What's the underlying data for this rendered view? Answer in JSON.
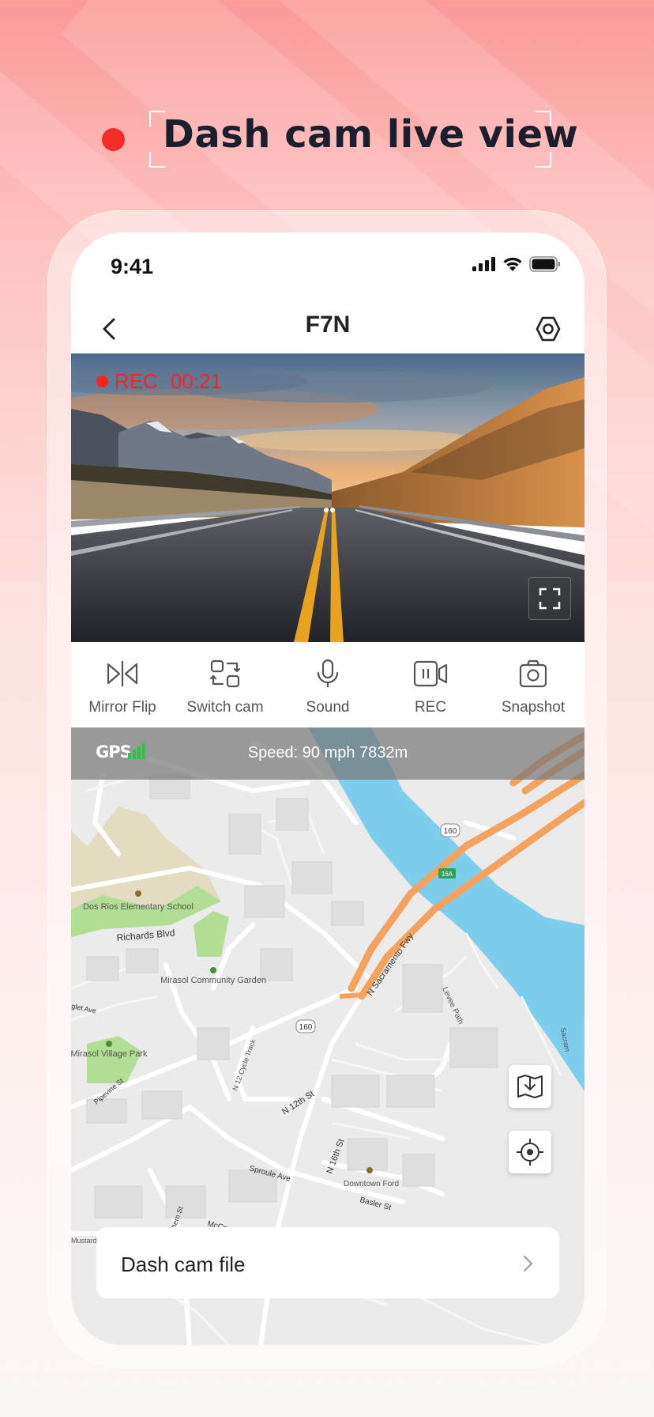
{
  "headline": {
    "title": "Dash cam live view"
  },
  "status_bar": {
    "time": "9:41"
  },
  "nav": {
    "title": "F7N"
  },
  "video": {
    "rec_label": "REC",
    "rec_timer": "00:21"
  },
  "controls": [
    {
      "label": "Mirror Flip",
      "icon": "mirror-flip-icon"
    },
    {
      "label": "Switch cam",
      "icon": "switch-cam-icon"
    },
    {
      "label": "Sound",
      "icon": "microphone-icon"
    },
    {
      "label": "REC",
      "icon": "record-video-icon"
    },
    {
      "label": "Snapshot",
      "icon": "camera-icon"
    }
  ],
  "gps": {
    "label": "GPS",
    "speed_text": "Speed: 90 mph  7832m",
    "signal_bars": 4
  },
  "map": {
    "labels": {
      "school": "Dos Rios Elementary School",
      "garden": "Mirasol Community Garden",
      "park": "Mirasol Village Park",
      "richards": "Richards Blvd",
      "sacramento_fwy": "N Sacramento Fwy",
      "levee": "Levee Path",
      "n12th": "N 12th St",
      "n16th": "N 16th St",
      "cycle": "N 12 Cycle Track",
      "sproule": "Sproule Ave",
      "basler": "Basler St",
      "mccormack": "McCormack Ave",
      "ahern": "Ahern St",
      "pipevine": "Pipevine St",
      "downtown_ford": "Downtown Ford",
      "mustard": "Mustard S",
      "glet": "glet Ave",
      "route160": "160",
      "route16a": "16A",
      "sacram": "Sacram"
    }
  },
  "file_card": {
    "label": "Dash cam file"
  },
  "colors": {
    "accent_red": "#f52a2a",
    "rec_red": "#ff1f1f",
    "river": "#7dcdec",
    "freeway": "#f5a25e",
    "park_green": "#b2dd95"
  }
}
